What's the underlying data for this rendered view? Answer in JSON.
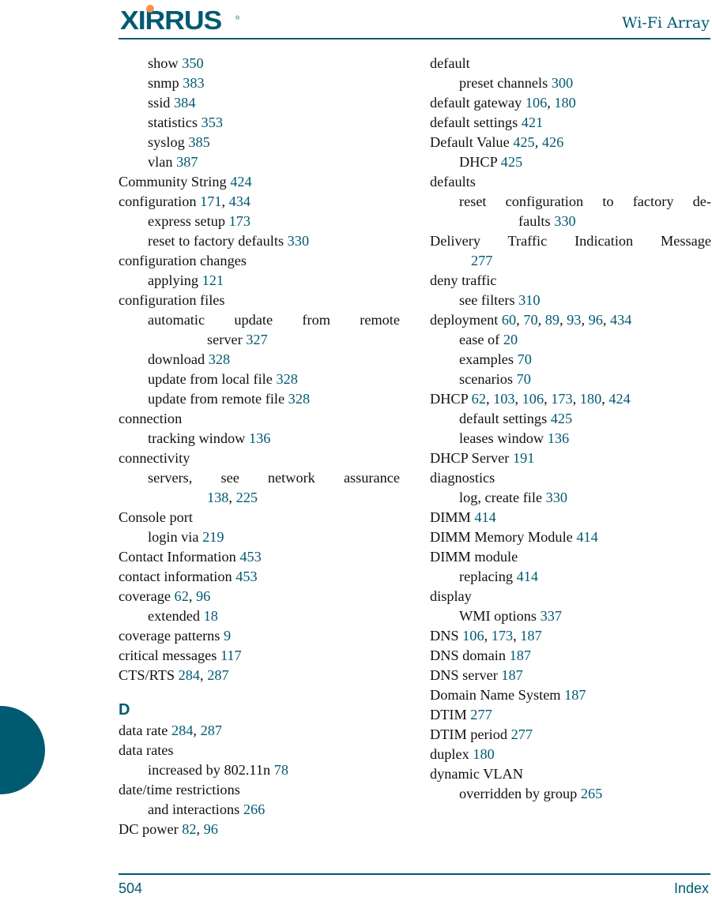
{
  "header": {
    "logo_text": "XIRRUS",
    "logo_registered": "®",
    "title": "Wi-Fi Array"
  },
  "footer": {
    "page_number": "504",
    "section": "Index"
  },
  "colors": {
    "accent": "#005a72",
    "logo_dot": "#f7944a"
  },
  "left_column": [
    {
      "level": 1,
      "term": "show",
      "pages": [
        "350"
      ]
    },
    {
      "level": 1,
      "term": "snmp",
      "pages": [
        "383"
      ]
    },
    {
      "level": 1,
      "term": "ssid",
      "pages": [
        "384"
      ]
    },
    {
      "level": 1,
      "term": "statistics",
      "pages": [
        "353"
      ]
    },
    {
      "level": 1,
      "term": "syslog",
      "pages": [
        "385"
      ]
    },
    {
      "level": 1,
      "term": "vlan",
      "pages": [
        "387"
      ]
    },
    {
      "level": 0,
      "term": "Community String",
      "pages": [
        "424"
      ]
    },
    {
      "level": 0,
      "term": "configuration",
      "pages": [
        "171",
        "434"
      ]
    },
    {
      "level": 1,
      "term": "express setup",
      "pages": [
        "173"
      ]
    },
    {
      "level": 1,
      "term": "reset to factory defaults",
      "pages": [
        "330"
      ]
    },
    {
      "level": 0,
      "term": "configuration changes",
      "pages": []
    },
    {
      "level": 1,
      "term": "applying",
      "pages": [
        "121"
      ]
    },
    {
      "level": 0,
      "term": "configuration files",
      "pages": []
    },
    {
      "level": 1,
      "term": "automatic update from remote",
      "cont": "server",
      "pages": [
        "327"
      ]
    },
    {
      "level": 1,
      "term": "download",
      "pages": [
        "328"
      ]
    },
    {
      "level": 1,
      "term": "update from local file",
      "pages": [
        "328"
      ]
    },
    {
      "level": 1,
      "term": "update from remote file",
      "pages": [
        "328"
      ]
    },
    {
      "level": 0,
      "term": "connection",
      "pages": []
    },
    {
      "level": 1,
      "term": "tracking window",
      "pages": [
        "136"
      ]
    },
    {
      "level": 0,
      "term": "connectivity",
      "pages": []
    },
    {
      "level": 1,
      "term": "servers, see network assurance",
      "cont": "",
      "pages": [
        "138",
        "225"
      ]
    },
    {
      "level": 0,
      "term": "Console port",
      "pages": []
    },
    {
      "level": 1,
      "term": "login via",
      "pages": [
        "219"
      ]
    },
    {
      "level": 0,
      "term": "Contact Information",
      "pages": [
        "453"
      ]
    },
    {
      "level": 0,
      "term": "contact information",
      "pages": [
        "453"
      ]
    },
    {
      "level": 0,
      "term": "coverage",
      "pages": [
        "62",
        "96"
      ]
    },
    {
      "level": 1,
      "term": "extended",
      "pages": [
        "18"
      ]
    },
    {
      "level": 0,
      "term": "coverage patterns",
      "pages": [
        "9"
      ]
    },
    {
      "level": 0,
      "term": "critical messages",
      "pages": [
        "117"
      ]
    },
    {
      "level": 0,
      "term": "CTS/RTS",
      "pages": [
        "284",
        "287"
      ]
    },
    {
      "letter": "D"
    },
    {
      "level": 0,
      "term": "data rate",
      "pages": [
        "284",
        "287"
      ]
    },
    {
      "level": 0,
      "term": "data rates",
      "pages": []
    },
    {
      "level": 1,
      "term": "increased by 802.11n",
      "pages": [
        "78"
      ]
    },
    {
      "level": 0,
      "term": "date/time restrictions",
      "pages": []
    },
    {
      "level": 1,
      "term": "and interactions",
      "pages": [
        "266"
      ]
    },
    {
      "level": 0,
      "term": "DC power",
      "pages": [
        "82",
        "96"
      ]
    }
  ],
  "right_column": [
    {
      "level": 0,
      "term": "default",
      "pages": []
    },
    {
      "level": 1,
      "term": "preset channels",
      "pages": [
        "300"
      ]
    },
    {
      "level": 0,
      "term": "default gateway",
      "pages": [
        "106",
        "180"
      ]
    },
    {
      "level": 0,
      "term": "default settings",
      "pages": [
        "421"
      ]
    },
    {
      "level": 0,
      "term": "Default Value",
      "pages": [
        "425",
        "426"
      ]
    },
    {
      "level": 1,
      "term": "DHCP",
      "pages": [
        "425"
      ]
    },
    {
      "level": 0,
      "term": "defaults",
      "pages": []
    },
    {
      "level": 1,
      "term": "reset configuration to factory de-",
      "cont": "faults",
      "pages": [
        "330"
      ]
    },
    {
      "level": 0,
      "term": "Delivery Traffic Indication Message",
      "cont": "",
      "pages": [
        "277"
      ]
    },
    {
      "level": 0,
      "term": "deny traffic",
      "pages": []
    },
    {
      "level": 1,
      "term": "see filters",
      "pages": [
        "310"
      ]
    },
    {
      "level": 0,
      "term": "deployment",
      "pages": [
        "60",
        "70",
        "89",
        "93",
        "96",
        "434"
      ]
    },
    {
      "level": 1,
      "term": "ease of",
      "pages": [
        "20"
      ]
    },
    {
      "level": 1,
      "term": "examples",
      "pages": [
        "70"
      ]
    },
    {
      "level": 1,
      "term": "scenarios",
      "pages": [
        "70"
      ]
    },
    {
      "level": 0,
      "term": "DHCP",
      "pages": [
        "62",
        "103",
        "106",
        "173",
        "180",
        "424"
      ]
    },
    {
      "level": 1,
      "term": "default settings",
      "pages": [
        "425"
      ]
    },
    {
      "level": 1,
      "term": "leases window",
      "pages": [
        "136"
      ]
    },
    {
      "level": 0,
      "term": "DHCP Server",
      "pages": [
        "191"
      ]
    },
    {
      "level": 0,
      "term": "diagnostics",
      "pages": []
    },
    {
      "level": 1,
      "term": "log, create file",
      "pages": [
        "330"
      ]
    },
    {
      "level": 0,
      "term": "DIMM",
      "pages": [
        "414"
      ]
    },
    {
      "level": 0,
      "term": "DIMM Memory Module",
      "pages": [
        "414"
      ]
    },
    {
      "level": 0,
      "term": "DIMM module",
      "pages": []
    },
    {
      "level": 1,
      "term": "replacing",
      "pages": [
        "414"
      ]
    },
    {
      "level": 0,
      "term": "display",
      "pages": []
    },
    {
      "level": 1,
      "term": "WMI options",
      "pages": [
        "337"
      ]
    },
    {
      "level": 0,
      "term": "DNS",
      "pages": [
        "106",
        "173",
        "187"
      ]
    },
    {
      "level": 0,
      "term": "DNS domain",
      "pages": [
        "187"
      ]
    },
    {
      "level": 0,
      "term": "DNS server",
      "pages": [
        "187"
      ]
    },
    {
      "level": 0,
      "term": "Domain Name System",
      "pages": [
        "187"
      ]
    },
    {
      "level": 0,
      "term": "DTIM",
      "pages": [
        "277"
      ]
    },
    {
      "level": 0,
      "term": "DTIM period",
      "pages": [
        "277"
      ]
    },
    {
      "level": 0,
      "term": "duplex",
      "pages": [
        "180"
      ]
    },
    {
      "level": 0,
      "term": "dynamic VLAN",
      "pages": []
    },
    {
      "level": 1,
      "term": "overridden by group",
      "pages": [
        "265"
      ]
    }
  ]
}
